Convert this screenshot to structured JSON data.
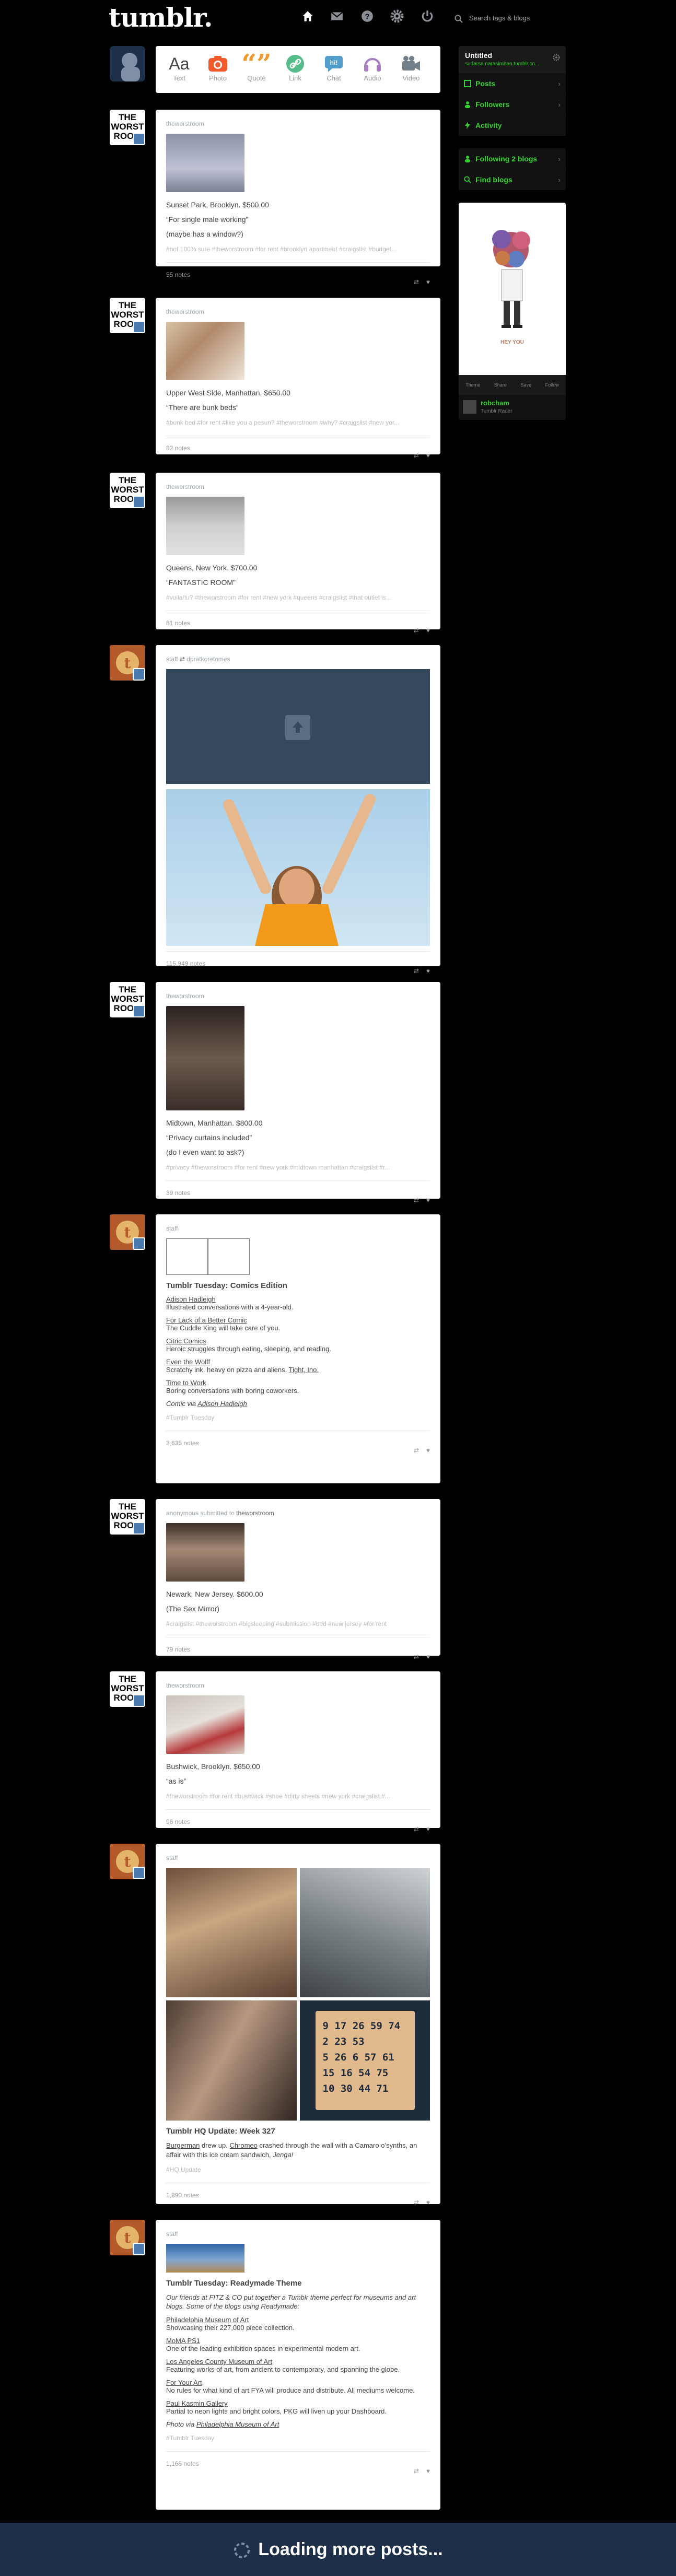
{
  "header": {
    "logo": "tumblr.",
    "search_placeholder": "Search tags & blogs",
    "nav_icons": [
      "home-icon",
      "mail-icon",
      "help-icon",
      "gear-icon",
      "power-icon"
    ]
  },
  "post_types": [
    {
      "label": "Text",
      "glyph": "Aa",
      "color": "#444444"
    },
    {
      "label": "Photo",
      "glyph": "camera",
      "color": "#ef5b2b"
    },
    {
      "label": "Quote",
      "glyph": "“”",
      "color": "#f2992e"
    },
    {
      "label": "Link",
      "glyph": "link",
      "color": "#56bc8a"
    },
    {
      "label": "Chat",
      "glyph": "chat",
      "color": "#529ecc"
    },
    {
      "label": "Audio",
      "glyph": "headphones",
      "color": "#a77dc2"
    },
    {
      "label": "Video",
      "glyph": "video",
      "color": "#748089"
    }
  ],
  "sidebar": {
    "blog_title": "Untitled",
    "blog_url": "sudarsa.narasimhan.tumblr.co...",
    "items": [
      {
        "label": "Posts",
        "icon": "posts-icon"
      },
      {
        "label": "Followers",
        "icon": "followers-icon"
      },
      {
        "label": "Activity",
        "icon": "activity-icon"
      }
    ],
    "following": "Following 2 blogs",
    "find_blogs": "Find blogs",
    "radar_caption": "HEY YOU",
    "radar_actions": [
      "Theme",
      "Share",
      "Save",
      "Follow"
    ],
    "radar_blog": "robcham",
    "radar_tag": "Tumblr Radar"
  },
  "posts": [
    {
      "id": "p1",
      "blog": "theworstroom",
      "title": "Sunset Park, Brooklyn. $500.00",
      "lines": [
        "“For single male working”",
        "(maybe has a window?)"
      ],
      "tags": "#not 100% sure  #theworstroom  #for rent  #brooklyn apartment  #craigslist  #budget...",
      "notes": "55 notes"
    },
    {
      "id": "p2",
      "blog": "theworstroom",
      "title": "Upper West Side, Manhattan. $650.00",
      "lines": [
        "“There are bunk beds”"
      ],
      "tags": "#bunk bed  #for rent  #like you a pesun?  #theworstroom  #why?  #craigslist  #new yor...",
      "notes": "82 notes"
    },
    {
      "id": "p3",
      "blog": "theworstroom",
      "title": "Queens, New York. $700.00",
      "lines": [
        "“FANTASTIC ROOM”"
      ],
      "tags": "#voila/tu?  #theworstroom  #for rent  #new york  #queens  #craigslist  #that outlet is...",
      "notes": "81 notes"
    },
    {
      "id": "p4",
      "blog": "staff",
      "reblog": "dpratkoretomes",
      "notes": "115,949 notes"
    },
    {
      "id": "p5",
      "blog": "theworstroom",
      "title": "Midtown, Manhattan. $800.00",
      "lines": [
        "“Privacy curtains included”",
        "(do I even want to ask?)"
      ],
      "tags": "#privacy  #theworstroom  #for rent  #new york  #midtown manhattan  #craigslist  #r...",
      "notes": "39 notes"
    },
    {
      "id": "p6",
      "blog": "staff",
      "heading": "Tumblr Tuesday: Comics Edition",
      "notes": "3,635 notes",
      "tags": "#Tumblr Tuesday",
      "items": [
        {
          "link": "Adison Hadleigh",
          "desc": "Illustrated conversations with a 4-year-old."
        },
        {
          "link": "For Lack of a Better Comic",
          "desc": "The Cuddle King will take care of you."
        },
        {
          "link": "Citric Comics",
          "desc": "Heroic struggles through eating, sleeping, and reading."
        },
        {
          "link": "Even the Wolff",
          "desc": "Scratchy ink, heavy on pizza and aliens.",
          "extra": "Tight, Ino."
        },
        {
          "link": "Time to Work",
          "desc": "Boring conversations with boring coworkers."
        }
      ],
      "via_prefix": "Comic via",
      "via_link": "Adison Hadleigh"
    },
    {
      "id": "p7",
      "blog": "anonymous",
      "submitted": "submitted to",
      "target": "theworstroom",
      "title": "Newark, New Jersey. $600.00",
      "lines": [
        "(The Sex Mirror)"
      ],
      "tags": "#craigslist  #theworstroom  #bigsleeping  #submission  #bed  #new jersey  #for rent",
      "notes": "79 notes"
    },
    {
      "id": "p8",
      "blog": "theworstroom",
      "title": "Bushwick, Brooklyn. $650.00",
      "lines": [
        "“as is”"
      ],
      "tags": "#theworstroom  #for rent  #bushwick  #shoe  #dirty sheets  #new york  #craigslist  #...",
      "notes": "96 notes"
    },
    {
      "id": "p9",
      "blog": "staff",
      "heading": "Tumblr HQ Update: Week 327",
      "body_link1": "Burgerman",
      "body_mid": "drew up.",
      "body_link2": "Chromeo",
      "body_rest": "crashed through the wall with a Camaro o’synths, an affair with this ice cream sandwich,",
      "body_it": "Jenga!",
      "tags": "#HQ Update",
      "notes": "1,890 notes",
      "bingo": "9 17 26 59 74\n2 23 53 \n5 26 6 57 61\n15 16 54 75\n10 30 44 71"
    },
    {
      "id": "p10",
      "blog": "staff",
      "heading": "Tumblr Tuesday: Readymade Theme",
      "intro": "Our friends at FITZ & CO put together a Tumblr theme perfect for museums and art blogs. Some of the blogs using Readymade:",
      "items": [
        {
          "link": "Philadelphia Museum of Art",
          "desc": "Showcasing their 227,000 piece collection."
        },
        {
          "link": "MoMA PS1",
          "desc": "One of the leading exhibition spaces in experimental modern art."
        },
        {
          "link": "Los Angeles County Museum of Art",
          "desc": "Featuring works of art, from ancient to contemporary, and spanning the globe."
        },
        {
          "link": "For Your Art",
          "desc": "No rules for what kind of art FYA will produce and distribute. All mediums welcome."
        },
        {
          "link": "Paul Kasmin Gallery",
          "desc": "Partial to neon lights and bright colors, PKG will liven up your Dashboard."
        }
      ],
      "via_prefix": "Photo via",
      "via_link": "Philadelphia Museum of Art",
      "tags": "#Tumblr Tuesday",
      "notes": "1,166 notes"
    }
  ],
  "loading": "Loading more posts..."
}
